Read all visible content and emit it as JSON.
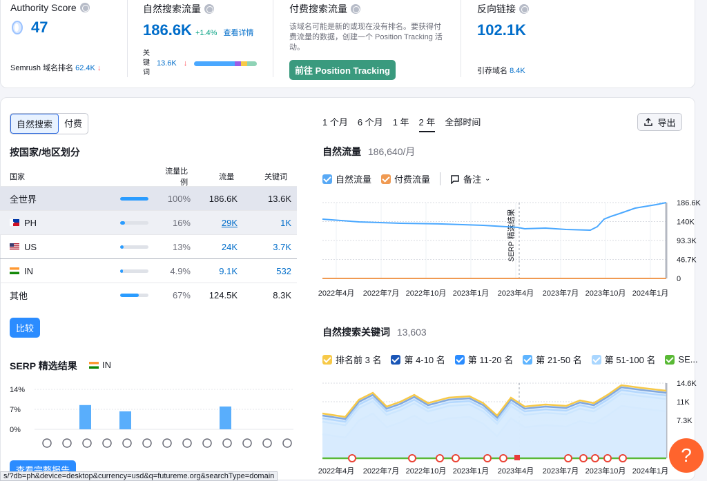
{
  "top": {
    "authority": {
      "label": "Authority Score",
      "value": "47",
      "rank_label": "Semrush 域名排名",
      "rank_value": "62.4K"
    },
    "organic": {
      "label": "自然搜索流量",
      "value": "186.6K",
      "change": "+1.4%",
      "details_link": "查看详情",
      "kw_label": "关键词",
      "kw_value": "13.6K"
    },
    "paid": {
      "label": "付费搜索流量",
      "note": "该域名可能是新的或现在没有排名。要获得付费流量的数据，创建一个 Position Tracking 活动。",
      "button": "前往 Position Tracking"
    },
    "backlinks": {
      "label": "反向链接",
      "value": "102.1K",
      "ref_label": "引荐域名",
      "ref_value": "8.4K"
    }
  },
  "left": {
    "seg_organic": "自然搜索",
    "seg_paid": "付费",
    "by_country_title": "按国家/地区划分",
    "headers": {
      "country": "国家",
      "share": "流量比例",
      "traffic": "流量",
      "keywords": "关键词"
    },
    "rows": [
      {
        "country": "全世界",
        "share_pct": 100,
        "share": "100%",
        "traffic": "186.6K",
        "keywords": "13.6K",
        "flag": "",
        "link": false
      },
      {
        "country": "PH",
        "share_pct": 16,
        "share": "16%",
        "traffic": "29K",
        "keywords": "1K",
        "flag": "ph",
        "link": true
      },
      {
        "country": "US",
        "share_pct": 13,
        "share": "13%",
        "traffic": "24K",
        "keywords": "3.7K",
        "flag": "us",
        "link": true
      },
      {
        "country": "IN",
        "share_pct": 4.9,
        "share": "4.9%",
        "traffic": "9.1K",
        "keywords": "532",
        "flag": "in",
        "link": true
      },
      {
        "country": "其他",
        "share_pct": 67,
        "share": "67%",
        "traffic": "124.5K",
        "keywords": "8.3K",
        "flag": "",
        "link": false
      }
    ],
    "compare_button": "比较",
    "serp_title": "SERP 精选结果",
    "serp_country": "IN",
    "serp_yticks": [
      "14%",
      "7%",
      "0%"
    ],
    "serp_values": [
      0,
      8.5,
      0,
      6.3,
      0,
      0,
      0,
      0,
      8.0,
      0,
      0,
      0,
      0,
      0
    ],
    "full_report_button": "查看完整报告"
  },
  "right": {
    "ranges": [
      "1 个月",
      "6 个月",
      "1 年",
      "2 年",
      "全部时间"
    ],
    "active_range": "2 年",
    "export": "导出",
    "traffic_title": "自然流量",
    "traffic_value": "186,640/月",
    "legend_organic": "自然流量",
    "legend_paid": "付费流量",
    "legend_notes": "备注",
    "serp_marker": "SERP 精选结果",
    "keywords_title": "自然搜索关键词",
    "keywords_value": "13,603",
    "kw_legend": [
      "排名前 3 名",
      "第 4-10 名",
      "第 11-20 名",
      "第 21-50 名",
      "第 51-100 名",
      "SE..."
    ],
    "kw_legend_colors": [
      "#f7c948",
      "#1a56b7",
      "#2b8cff",
      "#5eb4ff",
      "#a9d6ff",
      "#59b935"
    ]
  },
  "chart_data": [
    {
      "type": "line",
      "title": "自然流量",
      "x": [
        "2022年4月",
        "2022年7月",
        "2022年10月",
        "2023年1月",
        "2023年4月",
        "2023年7月",
        "2023年10月",
        "2024年1月"
      ],
      "series": [
        {
          "name": "自然流量",
          "values": [
            150000,
            145000,
            140000,
            136000,
            125000,
            122000,
            168000,
            186600
          ]
        },
        {
          "name": "付费流量",
          "values": [
            0,
            0,
            0,
            0,
            0,
            0,
            0,
            0
          ]
        }
      ],
      "yticks": [
        "186.6K",
        "140K",
        "93.3K",
        "46.7K",
        "0"
      ],
      "ylim": [
        0,
        186600
      ]
    },
    {
      "type": "area",
      "title": "自然搜索关键词",
      "x": [
        "2022年4月",
        "2022年7月",
        "2022年10月",
        "2023年1月",
        "2023年4月",
        "2023年7月",
        "2023年10月",
        "2024年1月"
      ],
      "yticks": [
        "14.6K",
        "11K",
        "7.3K"
      ]
    }
  ]
}
